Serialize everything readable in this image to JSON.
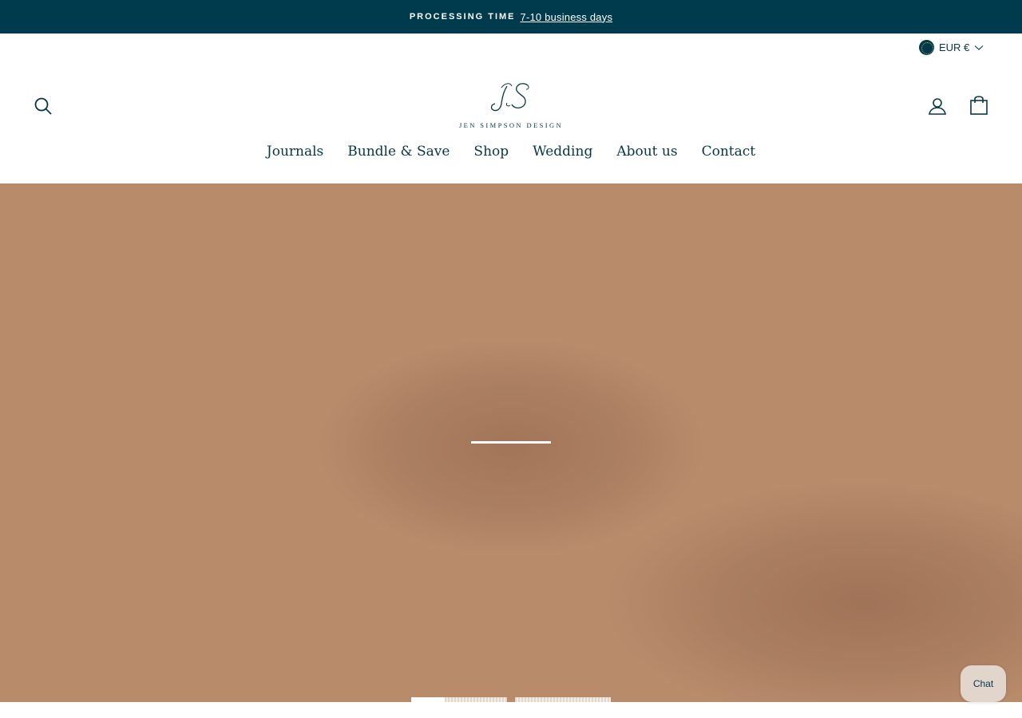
{
  "announcement": {
    "label": "PROCESSING TIME",
    "link_text": "7-10 business days"
  },
  "currency": {
    "selected": "EUR €",
    "flag_icon": "eu-flag-icon"
  },
  "header": {
    "logo_text": "JEN SIMPSON DESIGN",
    "logo_monogram": "JS",
    "icons": {
      "search": "search-icon",
      "account": "user-icon",
      "cart": "shopping-bag-icon"
    }
  },
  "nav": {
    "items": [
      {
        "label": "Journals"
      },
      {
        "label": "Bundle & Save"
      },
      {
        "label": "Shop"
      },
      {
        "label": "Wedding"
      },
      {
        "label": "About us"
      },
      {
        "label": "Contact"
      }
    ]
  },
  "hero": {
    "background_color": "#b88c6b",
    "slide_count": 3,
    "active_slide": 1
  },
  "chat": {
    "label": "Chat"
  },
  "colors": {
    "brand": "#003a4d",
    "text": "#063746"
  }
}
